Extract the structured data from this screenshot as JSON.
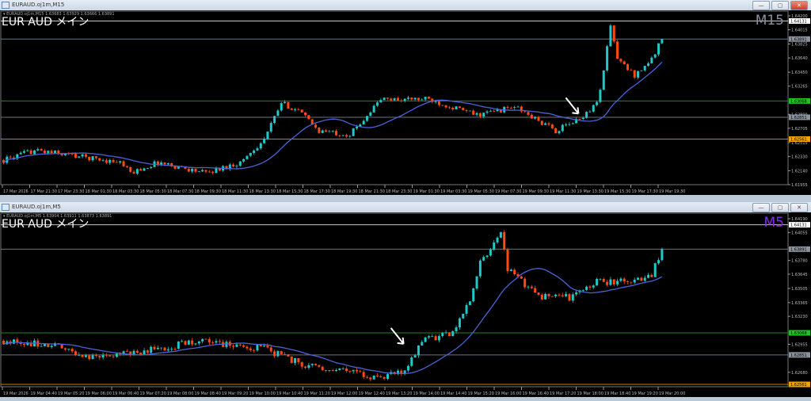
{
  "windows": [
    {
      "title": "EURAUD.oj1m,M15",
      "header": "▾ EURAUD.oj1m,M15  1.63683 1.63929 1.63666 1.63891",
      "label": "EUR AUD メイン",
      "timeframe": "M15",
      "timeframe_color": "#8a8fa0",
      "price_ticks": [
        "1.64200",
        "1.64015",
        "1.63825",
        "1.63640",
        "1.63450",
        "1.63265",
        "1.62890",
        "1.62705",
        "1.62515",
        "1.62330",
        "1.62140",
        "1.61955"
      ],
      "time_ticks": [
        "17 Mar 2026",
        "17 Mar 21:30",
        "17 Mar 23:30",
        "18 Mar 01:30",
        "18 Mar 03:30",
        "18 Mar 05:30",
        "18 Mar 07:30",
        "18 Mar 09:30",
        "18 Mar 11:30",
        "18 Mar 13:30",
        "18 Mar 15:30",
        "18 Mar 17:30",
        "18 Mar 19:30",
        "18 Mar 21:30",
        "18 Mar 23:30",
        "19 Mar 01:30",
        "19 Mar 03:30",
        "19 Mar 05:30",
        "19 Mar 07:30",
        "19 Mar 09:30",
        "19 Mar 11:30",
        "19 Mar 13:30",
        "19 Mar 15:30",
        "19 Mar 17:30",
        "19 Mar 19:30"
      ],
      "levels": [
        {
          "price": "1.64131",
          "color": "#c8c8c8",
          "bg": "#ffffff",
          "fg": "#000"
        },
        {
          "price": "1.63891",
          "color": "#6c7480",
          "bg": "#8a929c",
          "fg": "#000"
        },
        {
          "price": "1.63068",
          "color": "#1f8a1f",
          "bg": "#22c022",
          "fg": "#000"
        },
        {
          "price": "1.62851",
          "color": "#6c7480",
          "bg": "#8a929c",
          "fg": "#000"
        },
        {
          "price": "1.62561",
          "color": "#c87e00",
          "bg": "#f0a000",
          "fg": "#000"
        }
      ]
    },
    {
      "title": "EURAUD.oj1m,M5",
      "header": "▾ EURAUD.oj1m,M5  1.63904 1.63911 1.63873 1.63891",
      "label": "EUR AUD メイン",
      "timeframe": "M5",
      "timeframe_color": "#8a2be2",
      "price_ticks": [
        "1.64190",
        "1.64055",
        "1.63780",
        "1.63645",
        "1.63505",
        "1.63365",
        "1.63230",
        "1.62955",
        "1.62680"
      ],
      "time_ticks": [
        "19 Mar 2026",
        "19 Mar 04:40",
        "19 Mar 05:20",
        "19 Mar 06:00",
        "19 Mar 06:40",
        "19 Mar 07:20",
        "19 Mar 08:00",
        "19 Mar 08:40",
        "19 Mar 09:20",
        "19 Mar 10:00",
        "19 Mar 10:40",
        "19 Mar 11:20",
        "19 Mar 12:00",
        "19 Mar 12:40",
        "19 Mar 13:20",
        "19 Mar 14:00",
        "19 Mar 14:40",
        "19 Mar 15:20",
        "19 Mar 16:00",
        "19 Mar 16:40",
        "19 Mar 17:20",
        "19 Mar 18:00",
        "19 Mar 18:40",
        "19 Mar 19:20",
        "19 Mar 20:00"
      ],
      "levels": [
        {
          "price": "1.64131",
          "color": "#c8c8c8",
          "bg": "#ffffff",
          "fg": "#000"
        },
        {
          "price": "1.63891",
          "color": "#6c7480",
          "bg": "#8a929c",
          "fg": "#000"
        },
        {
          "price": "1.63068",
          "color": "#1f8a1f",
          "bg": "#22c022",
          "fg": "#000"
        },
        {
          "price": "1.62851",
          "color": "#6c7480",
          "bg": "#8a929c",
          "fg": "#000"
        },
        {
          "price": "1.62561",
          "color": "#c87e00",
          "bg": "#f0a000",
          "fg": "#000"
        }
      ]
    }
  ],
  "colors": {
    "bull": "#20c8c8",
    "bear": "#ff4a10",
    "ma": "#4a63d8",
    "background": "#000000"
  },
  "chart_data": [
    {
      "type": "candlestick",
      "title": "EURAUD M15",
      "ylim": [
        1.61955,
        1.64263
      ],
      "candles": 193,
      "ma_period": 20,
      "close_anchors": [
        [
          0,
          1.6228
        ],
        [
          9,
          1.6241
        ],
        [
          18,
          1.6236
        ],
        [
          34,
          1.6225
        ],
        [
          37,
          1.6211
        ],
        [
          45,
          1.6225
        ],
        [
          59,
          1.6211
        ],
        [
          69,
          1.6225
        ],
        [
          76,
          1.6256
        ],
        [
          81,
          1.6304
        ],
        [
          86,
          1.6294
        ],
        [
          92,
          1.6267
        ],
        [
          101,
          1.6262
        ],
        [
          110,
          1.6309
        ],
        [
          124,
          1.6309
        ],
        [
          138,
          1.6288
        ],
        [
          149,
          1.6299
        ],
        [
          161,
          1.6267
        ],
        [
          168,
          1.6283
        ],
        [
          173,
          1.6304
        ],
        [
          175,
          1.6346
        ],
        [
          177,
          1.6409
        ],
        [
          179,
          1.6362
        ],
        [
          184,
          1.6341
        ],
        [
          189,
          1.6362
        ],
        [
          192,
          1.63891
        ]
      ],
      "arrow_at": [
        168,
        1.629
      ]
    },
    {
      "type": "candlestick",
      "title": "EURAUD M5",
      "ylim": [
        1.62538,
        1.64245
      ],
      "candles": 193,
      "ma_period": 20,
      "close_anchors": [
        [
          0,
          1.6299
        ],
        [
          13,
          1.6295
        ],
        [
          27,
          1.6282
        ],
        [
          45,
          1.6291
        ],
        [
          57,
          1.6299
        ],
        [
          76,
          1.6291
        ],
        [
          87,
          1.6276
        ],
        [
          96,
          1.6272
        ],
        [
          108,
          1.6262
        ],
        [
          117,
          1.6268
        ],
        [
          122,
          1.6299
        ],
        [
          131,
          1.6307
        ],
        [
          136,
          1.6338
        ],
        [
          139,
          1.6377
        ],
        [
          142,
          1.6389
        ],
        [
          145,
          1.6408
        ],
        [
          147,
          1.6369
        ],
        [
          156,
          1.6342
        ],
        [
          166,
          1.6342
        ],
        [
          173,
          1.6357
        ],
        [
          184,
          1.6357
        ],
        [
          189,
          1.6365
        ],
        [
          192,
          1.63891
        ]
      ],
      "arrow_at": [
        117,
        1.6296
      ]
    }
  ]
}
